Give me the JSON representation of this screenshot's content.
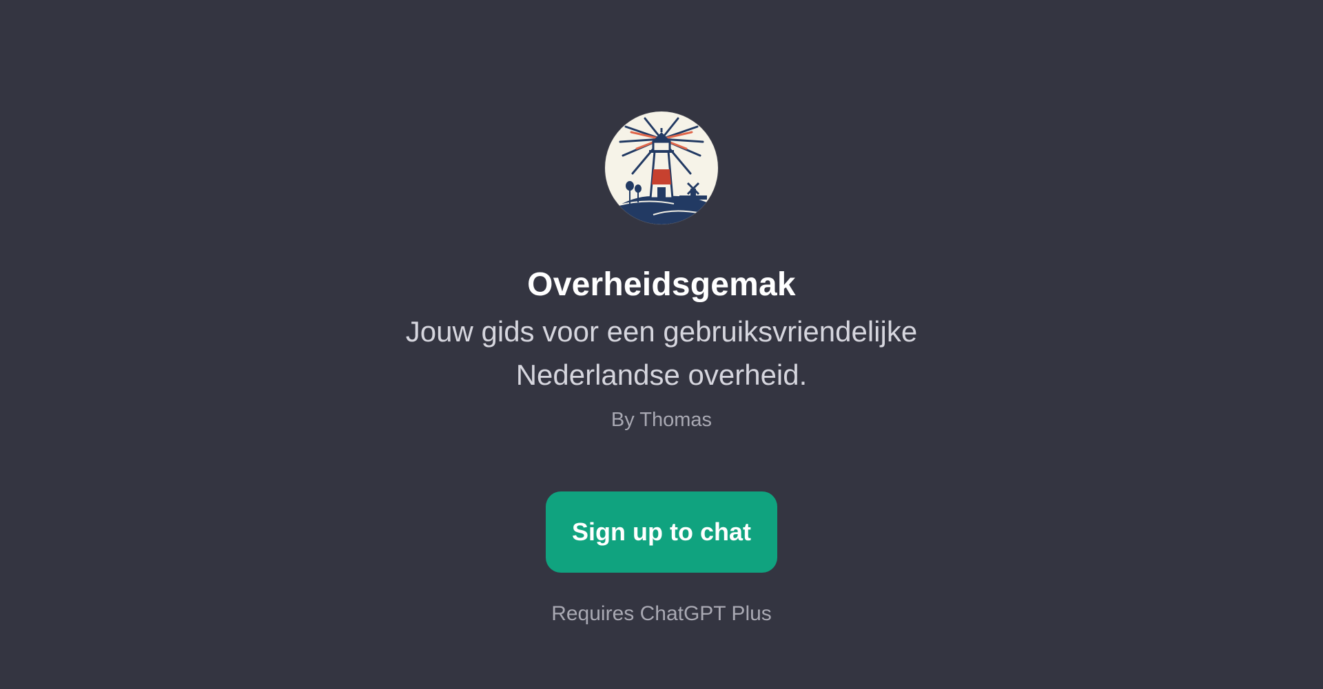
{
  "gpt": {
    "name": "Overheidsgemak",
    "description": "Jouw gids voor een gebruiksvriendelijke Nederlandse overheid.",
    "author": "By Thomas",
    "avatar_icon": "lighthouse-logo-icon"
  },
  "actions": {
    "signup_label": "Sign up to chat",
    "requirement": "Requires ChatGPT Plus"
  },
  "colors": {
    "background": "#343541",
    "button": "#10a37f",
    "title": "#ffffff",
    "description": "#d6d6de",
    "muted": "#a9a9b3"
  }
}
